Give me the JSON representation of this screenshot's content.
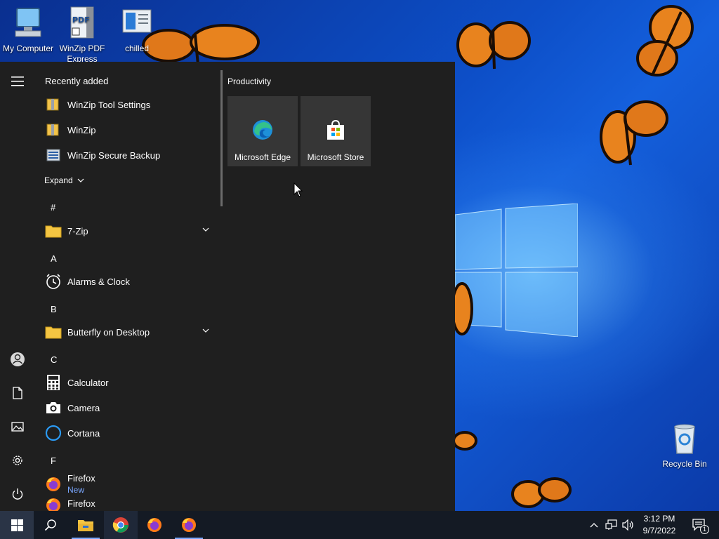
{
  "desktop": {
    "icons": [
      {
        "label": "My Computer"
      },
      {
        "label": "WinZip PDF Express"
      },
      {
        "label": "chilled"
      },
      {
        "label": "Recycle Bin"
      }
    ]
  },
  "start_menu": {
    "recently_added": {
      "title": "Recently added",
      "items": [
        {
          "label": "WinZip Tool Settings"
        },
        {
          "label": "WinZip"
        },
        {
          "label": "WinZip Secure Backup"
        }
      ],
      "expand_label": "Expand"
    },
    "groups": [
      {
        "letter": "#",
        "apps": [
          {
            "label": "7-Zip"
          }
        ]
      },
      {
        "letter": "A",
        "apps": [
          {
            "label": "Alarms & Clock"
          }
        ]
      },
      {
        "letter": "B",
        "apps": [
          {
            "label": "Butterfly on Desktop"
          }
        ]
      },
      {
        "letter": "C",
        "apps": [
          {
            "label": "Calculator"
          },
          {
            "label": "Camera"
          },
          {
            "label": "Cortana"
          }
        ]
      },
      {
        "letter": "F",
        "apps": [
          {
            "label": "Firefox",
            "badge": "New"
          },
          {
            "label": "Firefox"
          }
        ]
      }
    ],
    "tiles_group": {
      "title": "Productivity",
      "tiles": [
        {
          "label": "Microsoft Edge",
          "icon": "edge-icon"
        },
        {
          "label": "Microsoft Store",
          "icon": "store-icon"
        }
      ]
    },
    "rail_icons": [
      "hamburger-icon",
      "user-icon",
      "documents-icon",
      "pictures-icon",
      "settings-icon",
      "power-icon"
    ]
  },
  "taskbar": {
    "apps": [
      "file-explorer-icon",
      "chrome-icon",
      "firefox-icon",
      "firefox-icon"
    ],
    "clock": {
      "time": "3:12 PM",
      "date": "9/7/2022"
    },
    "notification_count": "1"
  },
  "colors": {
    "accent": "#7aa7ff",
    "menu_bg": "#1f1f1f",
    "tile_bg": "#363636",
    "taskbar_bg": "#141a24"
  }
}
